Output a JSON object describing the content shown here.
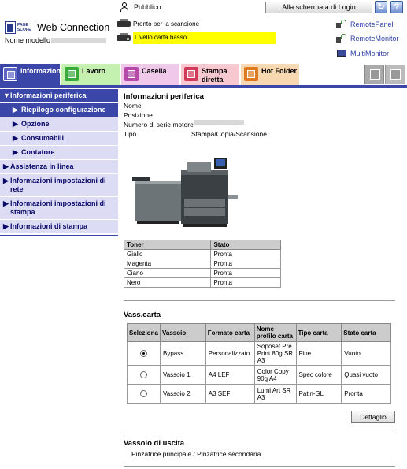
{
  "header": {
    "logo_small": "PAGE SCOPE",
    "logo_main": "Web Connection",
    "model_label": "Nome modello",
    "user_name": "Pubblico",
    "login_button": "Alla schermata di Login",
    "refresh_icon": "refresh-icon",
    "help_icon": "help-icon",
    "status_ready": "Pronto per la scansione",
    "status_paper": "Livello carta basso",
    "links": [
      "RemotePanel",
      "RemoteMonitor",
      "MultiMonitor"
    ]
  },
  "tabs": [
    {
      "label": "Informazione"
    },
    {
      "label": "Lavoro"
    },
    {
      "label": "Casella"
    },
    {
      "label": "Stampa diretta"
    },
    {
      "label": "Hot Folder"
    }
  ],
  "sidebar": {
    "items": [
      {
        "label": "Informazioni periferica"
      },
      {
        "label": "Riepilogo configurazione"
      },
      {
        "label": "Opzione"
      },
      {
        "label": "Consumabili"
      },
      {
        "label": "Contatore"
      },
      {
        "label": "Assistenza in linea"
      },
      {
        "label": "Informazioni impostazioni di rete"
      },
      {
        "label": "Informazioni impostazioni di stampa"
      },
      {
        "label": "Informazioni di stampa"
      }
    ]
  },
  "device": {
    "title": "Informazioni periferica",
    "name_label": "Nome",
    "position_label": "Posizione",
    "serial_label": "Numero di serie motore",
    "type_label": "Tipo",
    "type_value": "Stampa/Copia/Scansione"
  },
  "toner": {
    "headers": [
      "Toner",
      "Stato"
    ],
    "rows": [
      [
        "Giallo",
        "Pronta"
      ],
      [
        "Magenta",
        "Pronta"
      ],
      [
        "Ciano",
        "Pronta"
      ],
      [
        "Nero",
        "Pronta"
      ]
    ]
  },
  "trays": {
    "title": "Vass.carta",
    "headers": [
      "Seleziona",
      "Vassoio",
      "Formato carta",
      "Nome profilo carta",
      "Tipo carta",
      "Stato carta"
    ],
    "rows": [
      {
        "selected": true,
        "tray": "Bypass",
        "size": "Personalizzato",
        "profile": "Soposet Pre Print 80g SR A3",
        "type": "Fine",
        "status": "Vuoto"
      },
      {
        "selected": false,
        "tray": "Vassoio 1",
        "size": "A4 LEF",
        "profile": "Color Copy 90g A4",
        "type": "Spec colore",
        "status": "Quasi vuoto"
      },
      {
        "selected": false,
        "tray": "Vassoio 2",
        "size": "A3 SEF",
        "profile": "Lumi Art SR A3",
        "type": "Patin-GL",
        "status": "Pronta"
      }
    ],
    "detail_button": "Dettaglio"
  },
  "output": {
    "title": "Vassoio di uscita",
    "value": "Pinzatrice principale / Pinzatrice secondaria"
  }
}
